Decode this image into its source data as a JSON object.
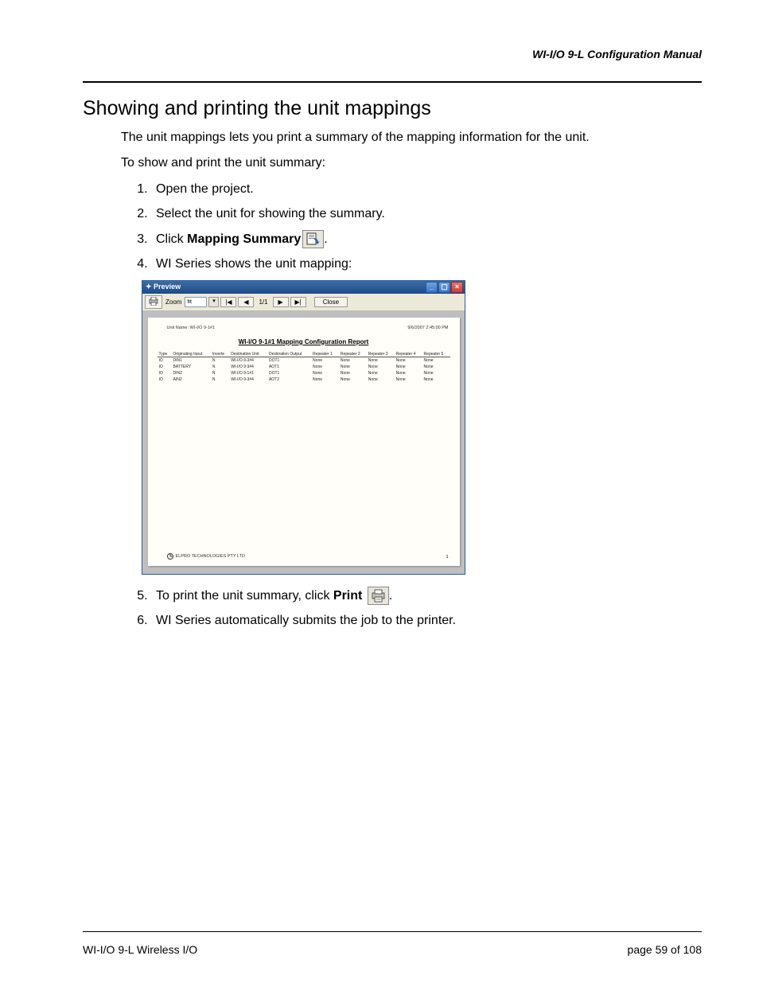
{
  "header_right": "WI-I/O 9-L Configuration Manual",
  "section_title": "Showing and printing the unit mappings",
  "intro_1": "The unit mappings lets you print a summary of the mapping information for the unit.",
  "intro_2": "To show and print the unit summary:",
  "steps": {
    "s1": "Open the project.",
    "s2": "Select the unit for showing the summary.",
    "s3_prefix": "Click ",
    "s3_bold": "Mapping Summary",
    "s3_suffix": ".",
    "s4": "WI Series shows the unit mapping:",
    "s5_prefix": "To print the unit summary, click ",
    "s5_bold": "Print",
    "s5_suffix": ".",
    "s6": "WI Series automatically submits the job to the printer."
  },
  "preview": {
    "title": "Preview",
    "toolbar": {
      "zoom_label": "Zoom",
      "zoom_value": "fit",
      "first": "|◀",
      "prev": "◀",
      "page_of": "1/1",
      "next": "▶",
      "last": "▶|",
      "close": "Close"
    },
    "report": {
      "meta_left": "Unit Name: WI-I/O 9-1#1",
      "meta_right": "9/6/2007 2:45:00 PM",
      "title": "WI-I/O 9-1#1 Mapping Configuration Report",
      "headers": {
        "type": "Type",
        "orig": "Originating Input",
        "inv": "Inverte",
        "destu": "Destination Unit",
        "desto": "Destination Output",
        "r1": "Repeater 1",
        "r2": "Repeater 2",
        "r3": "Repeater 3",
        "r4": "Repeater 4",
        "r5": "Repeater 5"
      },
      "rows": [
        {
          "type": "IO",
          "orig": "DIN1",
          "inv": "N",
          "destu": "WI-I/O 9-3#4",
          "desto": "DOT1",
          "r1": "None",
          "r2": "None",
          "r3": "None",
          "r4": "None",
          "r5": "None"
        },
        {
          "type": "IO",
          "orig": "BATTERY",
          "inv": "N",
          "destu": "WI-I/O 9-3#4",
          "desto": "AOT1",
          "r1": "None",
          "r2": "None",
          "r3": "None",
          "r4": "None",
          "r5": "None"
        },
        {
          "type": "IO",
          "orig": "DIN2",
          "inv": "N",
          "destu": "WI-I/O 9-1#1",
          "desto": "DOT1",
          "r1": "None",
          "r2": "None",
          "r3": "None",
          "r4": "None",
          "r5": "None"
        },
        {
          "type": "IO",
          "orig": "AIN2",
          "inv": "N",
          "destu": "WI-I/O 9-3#4",
          "desto": "AOT2",
          "r1": "None",
          "r2": "None",
          "r3": "None",
          "r4": "None",
          "r5": "None"
        }
      ],
      "footer_left": "ELPRO TECHNOLOGIES PTY LTD",
      "footer_right": "1"
    }
  },
  "footer": {
    "left": "WI-I/O 9-L Wireless I/O",
    "right_prefix": "page ",
    "page_cur": "59",
    "right_mid": " of ",
    "page_total": "108"
  }
}
